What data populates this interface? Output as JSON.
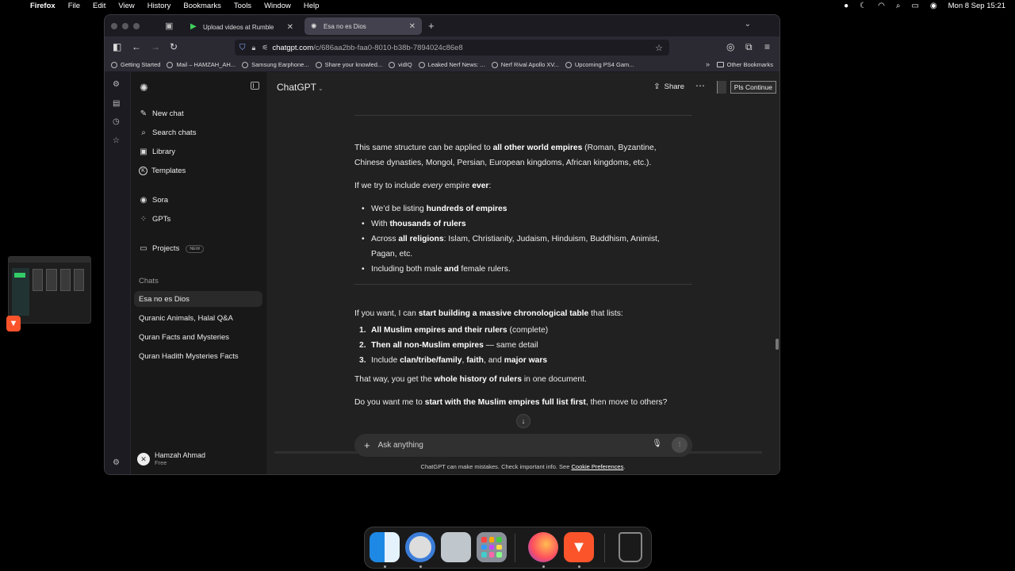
{
  "menubar": {
    "app": "Firefox",
    "items": [
      "File",
      "Edit",
      "View",
      "History",
      "Bookmarks",
      "Tools",
      "Window",
      "Help"
    ],
    "clock": "Mon 8 Sep  15:21"
  },
  "browser": {
    "tabs": [
      {
        "title": "Upload videos at Rumble",
        "active": false
      },
      {
        "title": "Esa no es Dios",
        "active": true
      }
    ],
    "url_host": "chatgpt.com",
    "url_path": "/c/686aa2bb-faa0-8010-b38b-7894024c86e8",
    "bookmarks": [
      "Getting Started",
      "Mail – HAMZAH_AH...",
      "Samsung Earphone...",
      "Share your knowled...",
      "vidIQ",
      "Leaked Nerf News: ...",
      "Nerf Rival Apollo XV...",
      "Upcoming PS4 Gam..."
    ],
    "other_bookmarks": "Other Bookmarks"
  },
  "sidebar": {
    "new_chat": "New chat",
    "search_chats": "Search chats",
    "library": "Library",
    "templates": "Templates",
    "sora": "Sora",
    "gpts": "GPTs",
    "projects": "Projects",
    "projects_badge": "NEW",
    "chats_heading": "Chats",
    "chats": [
      "Esa no es Dios",
      "Quranic Animals, Halal Q&A",
      "Quran Facts and Mysteries",
      "Quran Hadith Mysteries Facts"
    ],
    "user_name": "Hamzah Ahmad",
    "user_plan": "Free"
  },
  "topbar": {
    "model": "ChatGPT",
    "share": "Share",
    "extension_button": "Pls Continue"
  },
  "content": {
    "p1_pre": "This same structure can be applied to ",
    "p1_bold": "all other world empires",
    "p1_post": " (Roman, Byzantine, Chinese dynasties, Mongol, Persian, European kingdoms, African kingdoms, etc.).",
    "p2_pre": "If we try to include ",
    "p2_em": "every",
    "p2_mid": " empire ",
    "p2_bold": "ever",
    "p2_post": ":",
    "b1_pre": "We’d be listing ",
    "b1_bold": "hundreds of empires",
    "b2_pre": "With ",
    "b2_bold": "thousands of rulers",
    "b3_pre": "Across ",
    "b3_bold": "all religions",
    "b3_post": ": Islam, Christianity, Judaism, Hinduism, Buddhism, Animist, Pagan, etc.",
    "b4_pre": "Including both male ",
    "b4_bold": "and",
    "b4_post": " female rulers.",
    "p3_pre": "If you want, I can ",
    "p3_bold": "start building a massive chronological table",
    "p3_post": " that lists:",
    "n1_num": "1.",
    "n1_bold": "All Muslim empires and their rulers",
    "n1_post": " (complete)",
    "n2_num": "2.",
    "n2_bold": "Then all non-Muslim empires",
    "n2_post": " — same detail",
    "n3_num": "3.",
    "n3_pre": "Include ",
    "n3_b1": "clan/tribe/family",
    "n3_mid1": ", ",
    "n3_b2": "faith",
    "n3_mid2": ", and ",
    "n3_b3": "major wars",
    "p4_pre": "That way, you get the ",
    "p4_bold": "whole history of rulers",
    "p4_post": " in one document.",
    "p5_pre": "Do you want me to ",
    "p5_bold": "start with the Muslim empires full list first",
    "p5_post": ", then move to others?"
  },
  "composer": {
    "placeholder": "Ask anything"
  },
  "footer": {
    "disclaimer": "ChatGPT can make mistakes. Check important info. See ",
    "link": "Cookie Preferences",
    "end": "."
  }
}
